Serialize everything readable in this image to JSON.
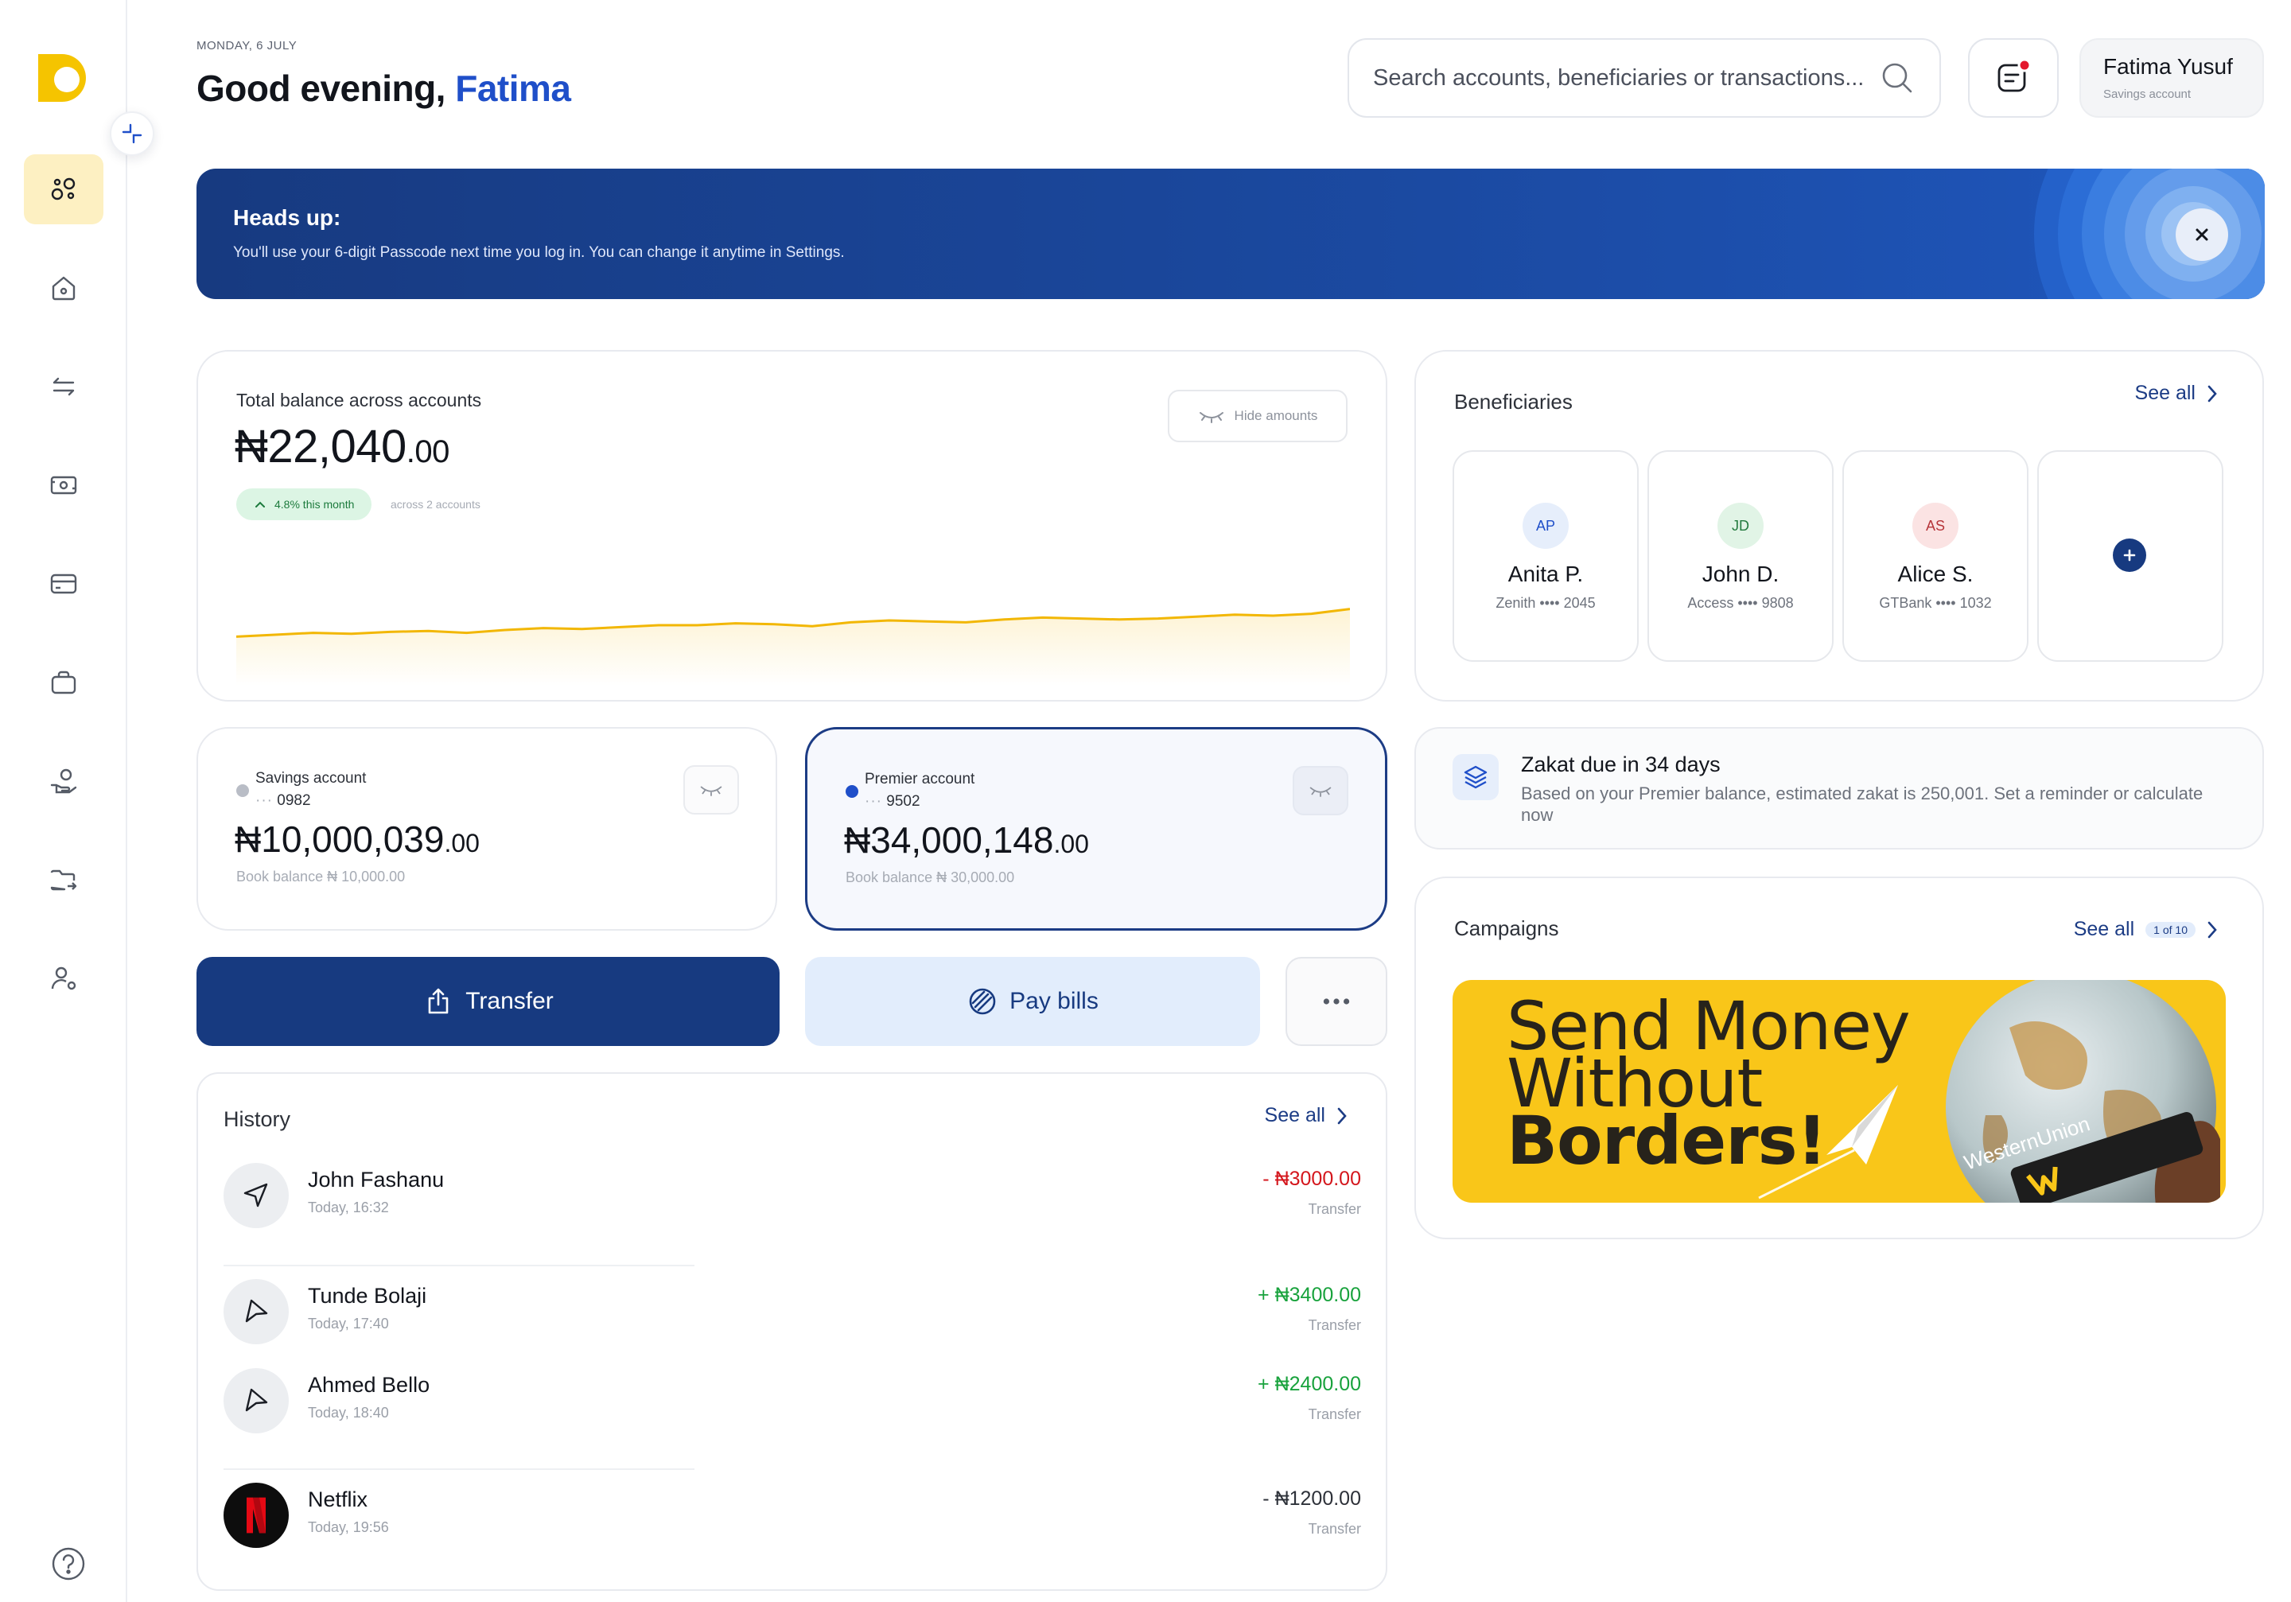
{
  "header": {
    "date": "MONDAY, 6 JULY",
    "greeting": "Good evening,",
    "user_first_name": "Fatima",
    "search_placeholder": "Search accounts, beneficiaries or transactions...",
    "profile_name": "Fatima Yusuf",
    "profile_sub": "Savings account"
  },
  "sidebar": {
    "items": [
      {
        "icon": "dashboard-icon",
        "active": true
      },
      {
        "icon": "home-icon",
        "active": false
      },
      {
        "icon": "transfer-arrows-icon",
        "active": false
      },
      {
        "icon": "money-bill-icon",
        "active": false
      },
      {
        "icon": "card-icon",
        "active": false
      },
      {
        "icon": "briefcase-icon",
        "active": false
      },
      {
        "icon": "loan-hand-icon",
        "active": false
      },
      {
        "icon": "folder-export-icon",
        "active": false
      },
      {
        "icon": "user-settings-icon",
        "active": false
      }
    ],
    "help_icon": "help-circle-icon"
  },
  "banner": {
    "title": "Heads up:",
    "text": "You'll use your 6-digit Passcode next time you log in. You can change it anytime in Settings."
  },
  "balance": {
    "label": "Total balance across accounts",
    "currency": "₦",
    "amount_int": "22,040",
    "amount_dec": ".00",
    "growth": "4.8% this month",
    "accounts_note": "across 2 accounts",
    "hide_label": "Hide amounts",
    "trend": [
      0.18,
      0.2,
      0.22,
      0.21,
      0.23,
      0.24,
      0.22,
      0.25,
      0.27,
      0.26,
      0.28,
      0.3,
      0.3,
      0.32,
      0.31,
      0.29,
      0.33,
      0.35,
      0.34,
      0.33,
      0.36,
      0.38,
      0.37,
      0.36,
      0.37,
      0.39,
      0.41,
      0.4,
      0.42,
      0.47
    ]
  },
  "beneficiaries": {
    "title": "Beneficiaries",
    "see_all": "See all",
    "items": [
      {
        "initials": "AP",
        "name": "Anita P.",
        "bank": "Zenith",
        "mask": "••••",
        "last4": "2045",
        "bg": "#e6eefb",
        "fg": "#1f4fc9"
      },
      {
        "initials": "JD",
        "name": "John D.",
        "bank": "Access",
        "mask": "••••",
        "last4": "9808",
        "bg": "#e1f4e6",
        "fg": "#237a3e"
      },
      {
        "initials": "AS",
        "name": "Alice S.",
        "bank": "GTBank",
        "mask": "••••",
        "last4": "1032",
        "bg": "#fbe3e3",
        "fg": "#b6353a"
      }
    ],
    "add_icon": "plus-icon"
  },
  "accounts": [
    {
      "name": "Savings account",
      "mask": "···",
      "number": "0982",
      "currency": "₦",
      "amount_int": "10,000,039",
      "amount_dec": ".00",
      "book_label": "Book balance",
      "book_value": "₦ 10,000.00",
      "dot": "#b9bdc6"
    },
    {
      "name": "Premier account",
      "mask": "···",
      "number": "9502",
      "currency": "₦",
      "amount_int": "34,000,148",
      "amount_dec": ".00",
      "book_label": "Book balance",
      "book_value": "₦ 30,000.00",
      "dot": "#1f4fc9"
    }
  ],
  "actions": {
    "transfer": "Transfer",
    "pay_bills": "Pay bills"
  },
  "history": {
    "title": "History",
    "see_all": "See all",
    "items": [
      {
        "name": "John Fashanu",
        "time": "Today, 16:32",
        "amount": "- ₦3000.00",
        "type": "Transfer",
        "color": "#d4161c",
        "icon": "send-icon"
      },
      {
        "name": "Tunde Bolaji",
        "time": "Today, 17:40",
        "amount": "+ ₦3400.00",
        "type": "Transfer",
        "color": "#18a23c",
        "icon": "receive-icon"
      },
      {
        "name": "Ahmed Bello",
        "time": "Today, 18:40",
        "amount": "+ ₦2400.00",
        "type": "Transfer",
        "color": "#18a23c",
        "icon": "receive-icon"
      },
      {
        "name": "Netflix",
        "time": "Today, 19:56",
        "amount": "- ₦1200.00",
        "type": "Transfer",
        "color": "#2d3139",
        "icon": "netflix-logo-icon"
      }
    ]
  },
  "zakat": {
    "title": "Zakat due in 34 days",
    "text": "Based on your Premier balance, estimated zakat is 250,001. Set a reminder or calculate now"
  },
  "campaigns": {
    "title": "Campaigns",
    "see_all": "See all",
    "counter": "1 of 10",
    "line1": "Send Money",
    "line2": "Without",
    "line3": "Borders!",
    "brand": "WesternUnion"
  },
  "colors": {
    "primary": "#173a80",
    "accent_yellow": "#f5c400",
    "link_blue": "#1f4fc9"
  }
}
